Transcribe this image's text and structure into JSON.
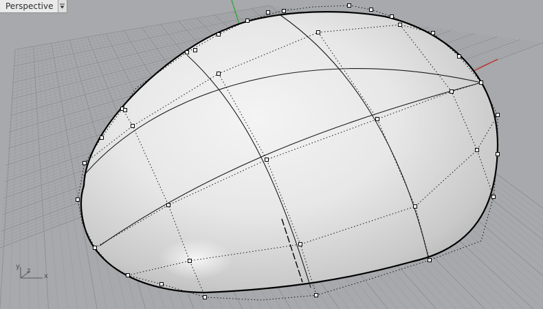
{
  "viewport": {
    "title": "Perspective",
    "dropdown_icon": "triangle-down-icon"
  },
  "axes_widget": {
    "x_label": "x",
    "y_label": "y",
    "z_label": "z"
  },
  "colors": {
    "background": "#a7a9ac",
    "grid_line": "#9b9da0",
    "grid_major": "#8f9194",
    "x_axis": "#c0302a",
    "y_axis": "#2fa638",
    "surface_edge": "#000000",
    "control_point_fill": "#ffffff"
  }
}
